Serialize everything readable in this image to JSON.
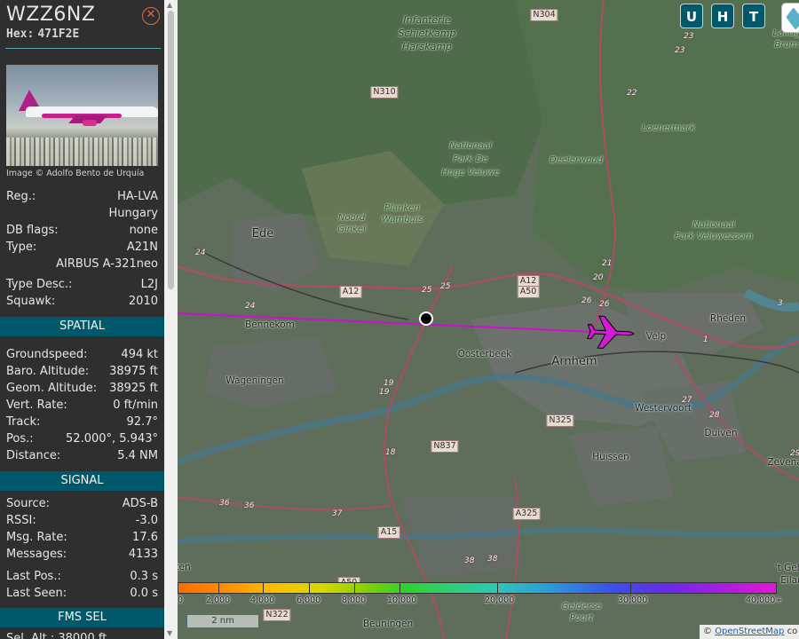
{
  "aircraft": {
    "callsign": "WZZ6NZ",
    "hex_label": "Hex:",
    "hex": "471F2E",
    "photo_credit": "Image © Adolfo Bento de Urquía"
  },
  "details": [
    {
      "label": "Reg.:",
      "value": "HA-LVA",
      "sub": "Hungary"
    },
    {
      "label": "DB flags:",
      "value": "none"
    },
    {
      "label": "Type:",
      "value": "A21N",
      "sub": "AIRBUS A-321neo"
    },
    {
      "label": "Type Desc.:",
      "value": "L2J"
    },
    {
      "label": "Squawk:",
      "value": "2010"
    }
  ],
  "sections": {
    "spatial": "SPATIAL",
    "signal": "SIGNAL",
    "fms": "FMS SEL"
  },
  "spatial": [
    {
      "label": "Groundspeed:",
      "value": "494 kt"
    },
    {
      "label": "Baro. Altitude:",
      "value": "38975 ft"
    },
    {
      "label": "Geom. Altitude:",
      "value": "38925 ft"
    },
    {
      "label": "Vert. Rate:",
      "value": "0 ft/min"
    },
    {
      "label": "Track:",
      "value": "92.7°"
    },
    {
      "label": "Pos.:",
      "value": "52.000°, 5.943°"
    },
    {
      "label": "Distance:",
      "value": "5.4 NM"
    }
  ],
  "signal": [
    {
      "label": "Source:",
      "value": "ADS-B"
    },
    {
      "label": "RSSI:",
      "value": "-3.0"
    },
    {
      "label": "Msg. Rate:",
      "value": "17.6"
    },
    {
      "label": "Messages:",
      "value": "4133"
    },
    {
      "label": "Last Pos.:",
      "value": "0.3 s"
    },
    {
      "label": "Last Seen:",
      "value": "0.0 s"
    }
  ],
  "fms_partial": "Sel. Alt.: 38000 ft",
  "map": {
    "buttons": [
      "U",
      "H",
      "T"
    ],
    "places": [
      {
        "t": "Infanterie",
        "k": "label"
      },
      {
        "t": "Schietkamp",
        "k": "label"
      },
      {
        "t": "Harskamp",
        "k": "label"
      },
      {
        "t": "Nationaal",
        "k": "park"
      },
      {
        "t": "Park De",
        "k": "park"
      },
      {
        "t": "Hoge Veluwe",
        "k": "park"
      },
      {
        "t": "Deelerwoud",
        "k": "park"
      },
      {
        "t": "Loenermark",
        "k": "park"
      },
      {
        "t": "Nationaal",
        "k": "park"
      },
      {
        "t": "Park Veluwezoom",
        "k": "park"
      },
      {
        "t": "Planken",
        "k": "park"
      },
      {
        "t": "Wambuis",
        "k": "park"
      },
      {
        "t": "Noord",
        "k": "park"
      },
      {
        "t": "Ginkel",
        "k": "park"
      },
      {
        "t": "Ede",
        "k": "city"
      },
      {
        "t": "Bennekom",
        "k": "town"
      },
      {
        "t": "Wageningen",
        "k": "town"
      },
      {
        "t": "Oosterbeek",
        "k": "town"
      },
      {
        "t": "Arnhem",
        "k": "city"
      },
      {
        "t": "Velp",
        "k": "town"
      },
      {
        "t": "Rheden",
        "k": "town"
      },
      {
        "t": "Westervoort",
        "k": "town"
      },
      {
        "t": "Duiven",
        "k": "town"
      },
      {
        "t": "Huissen",
        "k": "town"
      },
      {
        "t": "Zevena",
        "k": "town"
      },
      {
        "t": "Beuningen",
        "k": "town"
      },
      {
        "t": "Gelderse",
        "k": "park"
      },
      {
        "t": "Poort",
        "k": "park"
      },
      {
        "t": "Landg",
        "k": "park"
      },
      {
        "t": "Brum",
        "k": "park"
      },
      {
        "t": "'t Geld",
        "k": "town"
      },
      {
        "t": "Eilan",
        "k": "town"
      },
      {
        "t": "ten",
        "k": "town"
      }
    ],
    "shields": [
      "N304",
      "N310",
      "A12",
      "A12",
      "A50",
      "N325",
      "N837",
      "A325",
      "A15",
      "A50",
      "N322"
    ],
    "route_numbers": [
      "23",
      "23",
      "22",
      "21",
      "20",
      "26",
      "26",
      "25",
      "25",
      "24",
      "24",
      "19",
      "19",
      "18",
      "27",
      "28",
      "29",
      "36",
      "36",
      "37",
      "38",
      "38",
      "3",
      "1"
    ],
    "altitude_ticks": [
      "0",
      "2,000",
      "4,000",
      "6,000",
      "8,000",
      "10,000",
      "20,000",
      "30,000",
      "40,000+"
    ],
    "scale_label": "2 nm",
    "attribution_prefix": "©",
    "attribution_link": "OpenStreetMap",
    "attribution_suffix": "co"
  },
  "colors": {
    "sidebar_bg": "#2f2f2f",
    "section_bg": "#00596b",
    "track": "#cc11cc",
    "aircraft": "#d41ad4",
    "close": "#e06b4d"
  }
}
